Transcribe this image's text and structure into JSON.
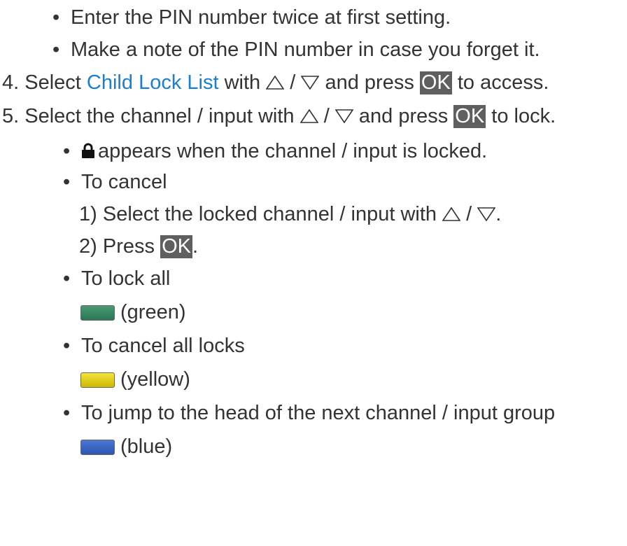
{
  "bullets_top": [
    "Enter the PIN number twice at first setting.",
    "Make a note of the PIN number in case you forget it."
  ],
  "step4": {
    "number": "4.",
    "select": "Select",
    "link": "Child Lock List",
    "with": "with",
    "slash": "/",
    "and_press": "and press",
    "ok": "OK",
    "tail": "to access."
  },
  "step5": {
    "number": "5.",
    "text": "Select the channel / input with",
    "slash": "/",
    "and_press": "and press",
    "ok": "OK",
    "tail": "to lock."
  },
  "lock_note": "appears when the channel / input is locked.",
  "to_cancel": {
    "label": "To cancel",
    "sub1_number": "1)",
    "sub1_text": "Select the locked channel / input with",
    "slash": "/",
    "period": ".",
    "sub2_number": "2)",
    "sub2_text": "Press",
    "ok": "OK",
    "sub2_period": "."
  },
  "to_lock_all": {
    "label": "To lock all",
    "button": "(green)",
    "color": "#2c7656"
  },
  "to_cancel_all": {
    "label": "To cancel all locks",
    "button": "(yellow)",
    "color": "#cdb900"
  },
  "to_jump": {
    "label": "To jump to the head of the next channel / input group",
    "button": "(blue)",
    "color": "#2b55b0"
  },
  "colors": {
    "text": "#333333",
    "link": "#1a7fd0",
    "ok_bg": "#5f5f5f"
  },
  "icons": [
    "up-triangle-icon",
    "down-triangle-icon",
    "lock-icon",
    "green-button-icon",
    "yellow-button-icon",
    "blue-button-icon"
  ]
}
